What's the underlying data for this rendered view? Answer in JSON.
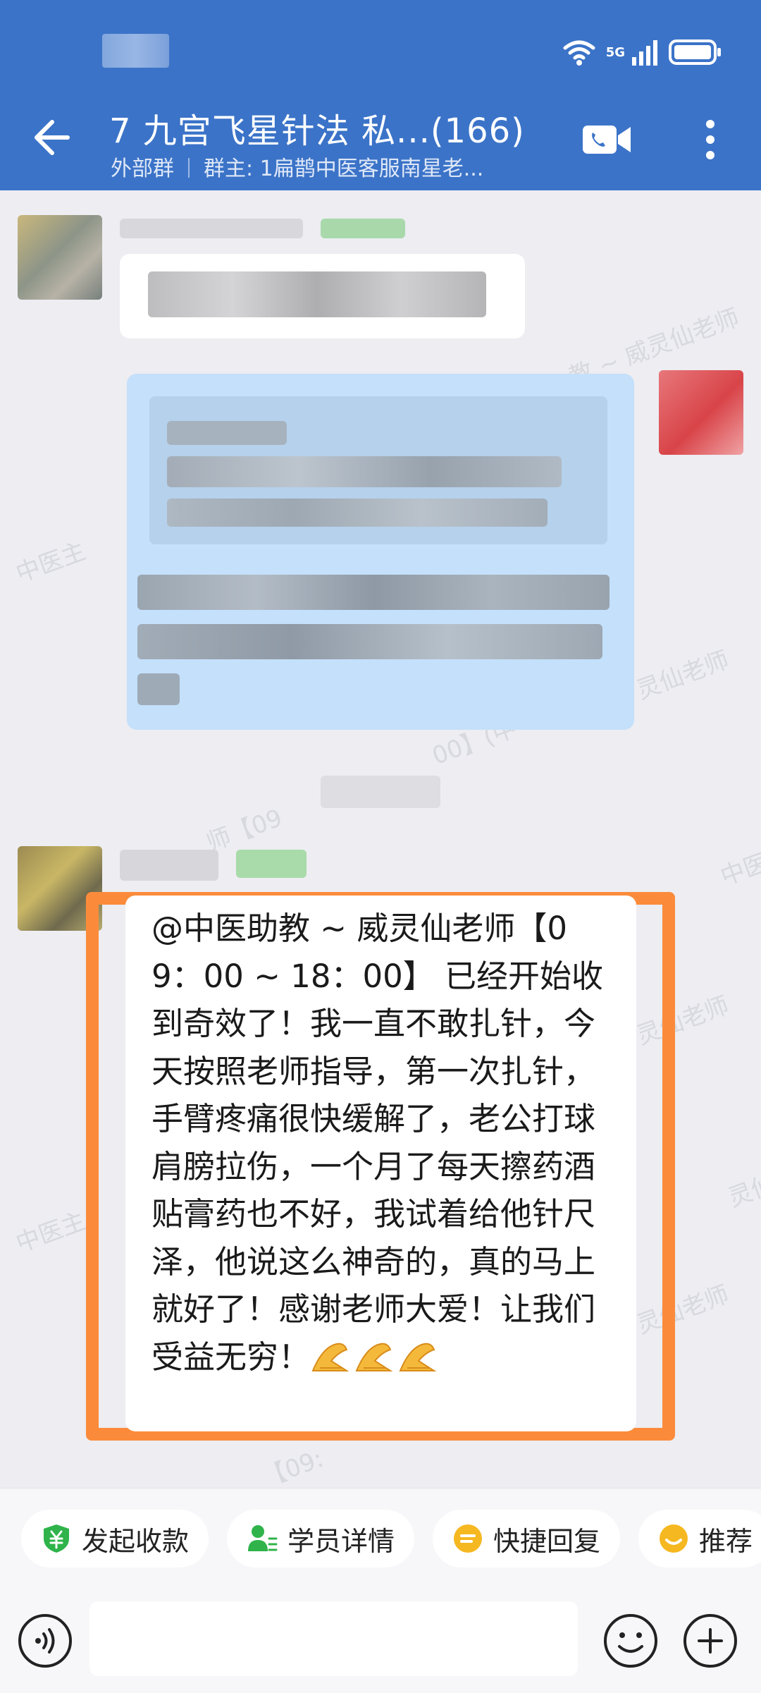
{
  "header": {
    "title": "7 九宫飞星针法 私...(166)",
    "group_type": "外部群",
    "owner": "群主: 1扁鹊中医客服南星老...",
    "network": "5G"
  },
  "watermark": "中医主 ~ 威灵仙老师 【09:00~18:00】",
  "watermark_fragments": [
    "教 ~ 威灵仙老师",
    "中医主",
    "灵仙老师",
    "00】(中",
    "师【09",
    "中医主",
    "灵仙老师",
    "灵仙老师",
    "中医主",
    "灵仙老师",
    "【09:"
  ],
  "message": {
    "text": "@中医助教 ~ 威灵仙老师【09：00 ~ 18：00】 已经开始收到奇效了！我一直不敢扎针，今天按照老师指导，第一次扎针，手臂疼痛很快缓解了，老公打球肩膀拉伤，一个月了每天擦药酒贴膏药也不好，我试着给他针尺泽，他说这么神奇的，真的马上就好了！感谢老师大爱！让我们受益无穷！",
    "emoji": "clapping-hands"
  },
  "actions": [
    {
      "label": "发起收款",
      "icon": "payment-icon"
    },
    {
      "label": "学员详情",
      "icon": "student-icon"
    },
    {
      "label": "快捷回复",
      "icon": "quick-reply-icon"
    },
    {
      "label": "推荐",
      "icon": "recommend-icon"
    }
  ],
  "colors": {
    "header": "#3b73c8",
    "highlight": "#fb8b3b",
    "bubble_blue": "#c4e0fb",
    "chat_bg": "#ededf2"
  }
}
